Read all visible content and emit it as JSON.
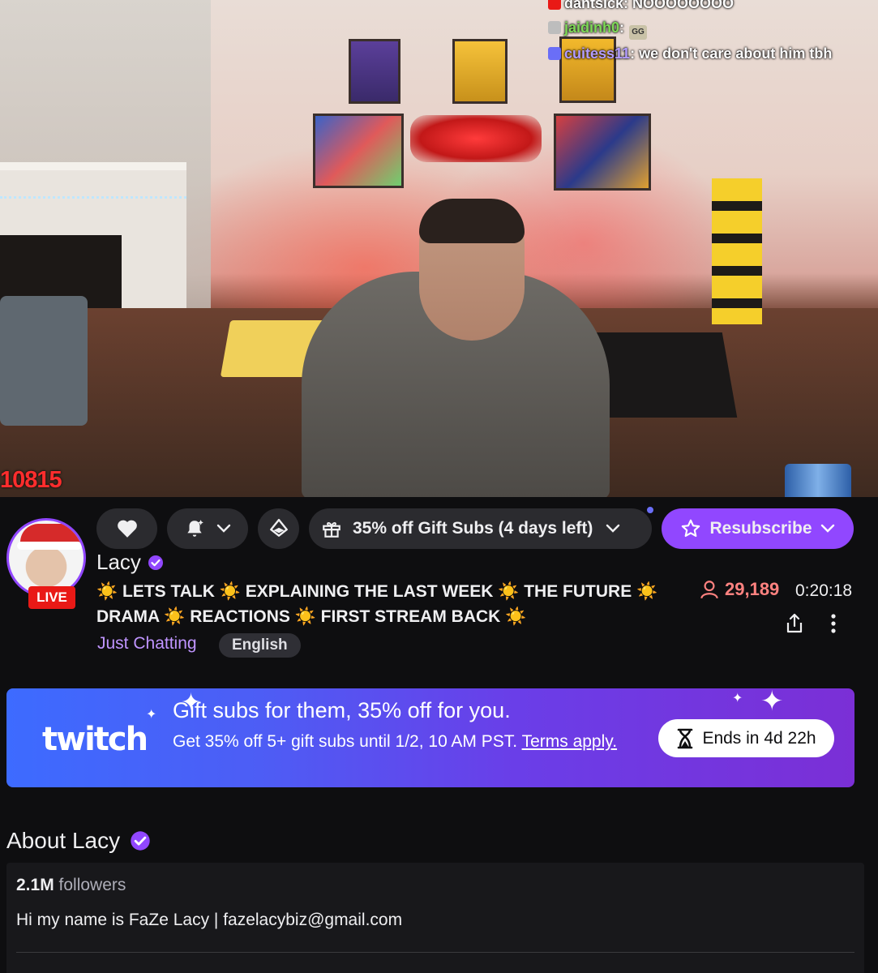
{
  "stream": {
    "overlay_id": "10815",
    "chat": [
      {
        "user": "dantsick",
        "user_color": "#ffffff",
        "badge_color": "#e91916",
        "message": "NOOOOOOOO"
      },
      {
        "user": "jaidinh0",
        "user_color": "#7ed957",
        "badge_color": "#bdbdbd",
        "message": "",
        "emote": "GG"
      },
      {
        "user": "cuitess11",
        "user_color": "#b29cff",
        "badge_color": "#6a6ef7",
        "message": "we don't care about him tbh"
      }
    ]
  },
  "actions": {
    "follow_icon": "heart-icon",
    "notification_icon": "bell-icon",
    "bits_icon": "bits-icon",
    "gift_label": "35% off Gift Subs (4 days left)",
    "resub_label": "Resubscribe"
  },
  "channel": {
    "name": "Lacy",
    "live_label": "LIVE",
    "title": "☀️ LETS TALK ☀️ EXPLAINING THE LAST WEEK ☀️ THE FUTURE ☀️ DRAMA ☀️ REACTIONS ☀️ FIRST STREAM BACK ☀️",
    "category": "Just Chatting",
    "language": "English",
    "viewers": "29,189",
    "uptime": "0:20:18"
  },
  "promo": {
    "brand": "twitch",
    "headline": "Gift subs for them, 35% off for you.",
    "description": "Get 35% off 5+ gift subs until 1/2, 10 AM PST.",
    "terms_link": "Terms apply.",
    "ends_label": "Ends in 4d 22h"
  },
  "about": {
    "title": "About Lacy",
    "followers_count": "2.1M",
    "followers_label": "followers",
    "bio": "Hi my name is FaZe Lacy | fazelacybiz@gmail.com"
  },
  "colors": {
    "accent": "#9147ff",
    "live": "#e91916",
    "viewers": "#ff8280",
    "category": "#bf94ff",
    "background": "#0e0e10"
  }
}
